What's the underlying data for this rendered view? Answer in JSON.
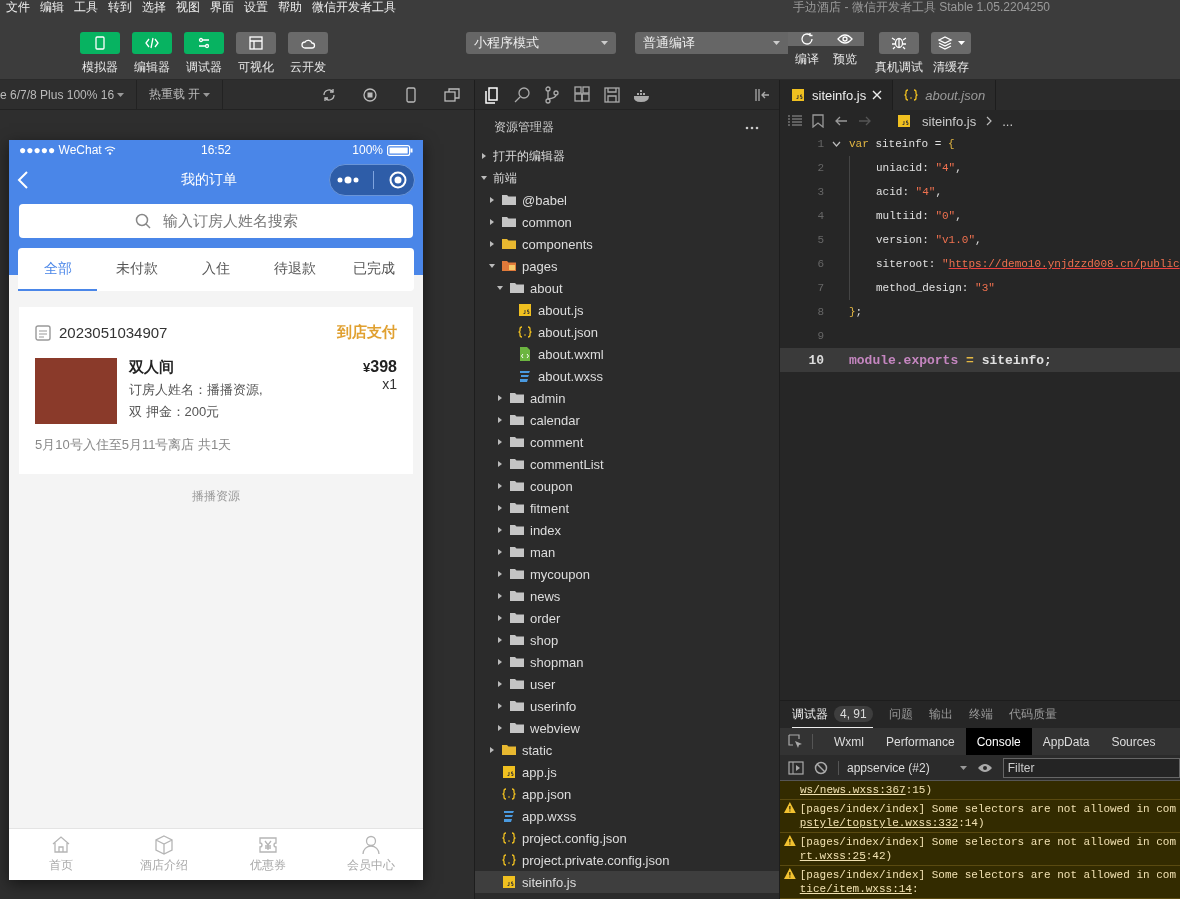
{
  "menu_bar": {
    "items": [
      "文件",
      "编辑",
      "工具",
      "转到",
      "选择",
      "视图",
      "界面",
      "设置",
      "帮助",
      "微信开发者工具"
    ],
    "title": "手边酒店 - 微信开发者工具 Stable 1.05.2204250"
  },
  "toolbar": {
    "view_toggles": [
      {
        "label": "模拟器",
        "on": true
      },
      {
        "label": "编辑器",
        "on": true
      },
      {
        "label": "调试器",
        "on": true
      },
      {
        "label": "可视化",
        "on": false
      },
      {
        "label": "云开发",
        "on": false
      }
    ],
    "mode_select": "小程序模式",
    "compile_select": "普通编译",
    "compile_actions": [
      "编译",
      "预览"
    ],
    "actions": [
      "真机调试",
      "清缓存"
    ]
  },
  "simulator": {
    "device": "e 6/7/8 Plus 100% 16",
    "hot_reload": "热重载 开",
    "phone": {
      "carrier": "●●●●● WeChat",
      "time": "16:52",
      "battery": "100%",
      "title": "我的订单",
      "search": {
        "placeholder": "输入订房人姓名搜索"
      },
      "tabs": [
        {
          "label": "全部",
          "selected": true
        },
        {
          "label": "未付款",
          "selected": false
        },
        {
          "label": "入住",
          "selected": false
        },
        {
          "label": "待退款",
          "selected": false
        },
        {
          "label": "已完成",
          "selected": false
        }
      ],
      "orders": [
        {
          "number": "2023051034907",
          "status": "到店支付",
          "room": "双人间",
          "details": [
            "订房人姓名：播播资源,",
            "双 押金：200元"
          ],
          "currency": "¥",
          "price": "398",
          "quantity": "x1",
          "dates": "5月10号入住至5月11号离店 共1天"
        }
      ],
      "footer": "播播资源",
      "tab_bar": [
        "首页",
        "酒店介绍",
        "优惠券",
        "会员中心"
      ]
    }
  },
  "explorer": {
    "title": "资源管理器",
    "tree": [
      {
        "name": "打开的编辑器",
        "kind": "section",
        "expanded": false,
        "selected": false
      },
      {
        "name": "前端",
        "kind": "section",
        "expanded": true,
        "selected": false,
        "children": [
          {
            "name": "@babel",
            "kind": "folder",
            "expanded": false,
            "selected": false
          },
          {
            "name": "common",
            "kind": "folder",
            "expanded": false,
            "selected": false
          },
          {
            "name": "components",
            "kind": "folder-yellow",
            "expanded": false,
            "selected": false
          },
          {
            "name": "pages",
            "kind": "folder-orange",
            "expanded": true,
            "selected": false,
            "children": [
              {
                "name": "about",
                "kind": "folder",
                "expanded": true,
                "selected": false,
                "children": [
                  {
                    "name": "about.js",
                    "kind": "js",
                    "selected": false
                  },
                  {
                    "name": "about.json",
                    "kind": "json",
                    "selected": false
                  },
                  {
                    "name": "about.wxml",
                    "kind": "wxml",
                    "selected": false
                  },
                  {
                    "name": "about.wxss",
                    "kind": "wxss",
                    "selected": false
                  }
                ]
              },
              {
                "name": "admin",
                "kind": "folder",
                "expanded": false,
                "selected": false
              },
              {
                "name": "calendar",
                "kind": "folder",
                "expanded": false,
                "selected": false
              },
              {
                "name": "comment",
                "kind": "folder",
                "expanded": false,
                "selected": false
              },
              {
                "name": "commentList",
                "kind": "folder",
                "expanded": false,
                "selected": false
              },
              {
                "name": "coupon",
                "kind": "folder",
                "expanded": false,
                "selected": false
              },
              {
                "name": "fitment",
                "kind": "folder",
                "expanded": false,
                "selected": false
              },
              {
                "name": "index",
                "kind": "folder",
                "expanded": false,
                "selected": false
              },
              {
                "name": "man",
                "kind": "folder",
                "expanded": false,
                "selected": false
              },
              {
                "name": "mycoupon",
                "kind": "folder",
                "expanded": false,
                "selected": false
              },
              {
                "name": "news",
                "kind": "folder",
                "expanded": false,
                "selected": false
              },
              {
                "name": "order",
                "kind": "folder",
                "expanded": false,
                "selected": false
              },
              {
                "name": "shop",
                "kind": "folder",
                "expanded": false,
                "selected": false
              },
              {
                "name": "shopman",
                "kind": "folder",
                "expanded": false,
                "selected": false
              },
              {
                "name": "user",
                "kind": "folder",
                "expanded": false,
                "selected": false
              },
              {
                "name": "userinfo",
                "kind": "folder",
                "expanded": false,
                "selected": false
              },
              {
                "name": "webview",
                "kind": "folder",
                "expanded": false,
                "selected": false
              }
            ]
          },
          {
            "name": "static",
            "kind": "folder-yellow",
            "expanded": false,
            "selected": false
          },
          {
            "name": "app.js",
            "kind": "js",
            "selected": false
          },
          {
            "name": "app.json",
            "kind": "json",
            "selected": false
          },
          {
            "name": "app.wxss",
            "kind": "wxss",
            "selected": false
          },
          {
            "name": "project.config.json",
            "kind": "json",
            "selected": false
          },
          {
            "name": "project.private.config.json",
            "kind": "json",
            "selected": false
          },
          {
            "name": "siteinfo.js",
            "kind": "js",
            "selected": true
          }
        ]
      }
    ]
  },
  "editor": {
    "tabs": [
      {
        "label": "siteinfo.js",
        "kind": "js",
        "selected": true
      },
      {
        "label": "about.json",
        "kind": "json",
        "selected": false
      }
    ],
    "breadcrumb": [
      "siteinfo.js",
      "..."
    ],
    "lines": [
      {
        "number": "1",
        "foldable": true,
        "current": false,
        "indented": false,
        "tokens": [
          {
            "text": "var",
            "kind": "keyword"
          },
          {
            "text": " siteinfo = ",
            "kind": "plain"
          },
          {
            "text": "{",
            "kind": "brace"
          }
        ]
      },
      {
        "number": "2",
        "foldable": false,
        "current": false,
        "indented": true,
        "tokens": [
          {
            "text": "uniacid: ",
            "kind": "plain"
          },
          {
            "text": "\"4\"",
            "kind": "string"
          },
          {
            "text": ",",
            "kind": "plain"
          }
        ]
      },
      {
        "number": "3",
        "foldable": false,
        "current": false,
        "indented": true,
        "tokens": [
          {
            "text": "acid: ",
            "kind": "plain"
          },
          {
            "text": "\"4\"",
            "kind": "string"
          },
          {
            "text": ",",
            "kind": "plain"
          }
        ]
      },
      {
        "number": "4",
        "foldable": false,
        "current": false,
        "indented": true,
        "tokens": [
          {
            "text": "multiid: ",
            "kind": "plain"
          },
          {
            "text": "\"0\"",
            "kind": "string"
          },
          {
            "text": ",",
            "kind": "plain"
          }
        ]
      },
      {
        "number": "5",
        "foldable": false,
        "current": false,
        "indented": true,
        "tokens": [
          {
            "text": "version: ",
            "kind": "plain"
          },
          {
            "text": "\"v1.0\"",
            "kind": "string"
          },
          {
            "text": ",",
            "kind": "plain"
          }
        ]
      },
      {
        "number": "6",
        "foldable": false,
        "current": false,
        "indented": true,
        "tokens": [
          {
            "text": "siteroot: ",
            "kind": "plain"
          },
          {
            "text": "\"",
            "kind": "string"
          },
          {
            "text": "https://demo10.ynjdzzd008.cn/public",
            "kind": "url"
          }
        ]
      },
      {
        "number": "7",
        "foldable": false,
        "current": false,
        "indented": true,
        "tokens": [
          {
            "text": "method_design: ",
            "kind": "plain"
          },
          {
            "text": "\"3\"",
            "kind": "string"
          }
        ]
      },
      {
        "number": "8",
        "foldable": false,
        "current": false,
        "indented": false,
        "tokens": [
          {
            "text": "}",
            "kind": "brace"
          },
          {
            "text": ";",
            "kind": "plain"
          }
        ]
      },
      {
        "number": "9",
        "foldable": false,
        "current": false,
        "indented": false
      },
      {
        "number": "10",
        "foldable": false,
        "current": true,
        "indented": false,
        "tokens": [
          {
            "text": "module.exports",
            "kind": "member"
          },
          {
            "text": " = ",
            "kind": "operator"
          },
          {
            "text": "siteinfo;",
            "kind": "plain"
          }
        ]
      }
    ]
  },
  "debug": {
    "tabs": [
      {
        "label": "调试器",
        "badge": "4, 91",
        "selected": true
      },
      {
        "label": "问题",
        "selected": false
      },
      {
        "label": "输出",
        "selected": false
      },
      {
        "label": "终端",
        "selected": false
      },
      {
        "label": "代码质量",
        "selected": false
      }
    ],
    "devtools_tabs": [
      {
        "label": "Wxml",
        "selected": false
      },
      {
        "label": "Performance",
        "selected": false
      },
      {
        "label": "Console",
        "selected": true
      },
      {
        "label": "AppData",
        "selected": false
      },
      {
        "label": "Sources",
        "selected": false
      }
    ],
    "context": "appservice (#2)",
    "filter": {
      "placeholder": "Filter"
    },
    "messages": [
      {
        "kind": "continuation",
        "link": "ws/news.wxss:367",
        "suffix": ":15)"
      },
      {
        "kind": "warning",
        "text": "[pages/index/index] Some selectors are not allowed in com",
        "link": "pstyle/topstyle.wxss:332",
        "suffix": ":14)"
      },
      {
        "kind": "warning",
        "text": "[pages/index/index] Some selectors are not allowed in com",
        "link": "rt.wxss:25",
        "suffix": ":42)"
      },
      {
        "kind": "warning",
        "text": "[pages/index/index] Some selectors are not allowed in com",
        "link": "tice/item.wxss:14",
        "suffix": ":"
      }
    ]
  }
}
